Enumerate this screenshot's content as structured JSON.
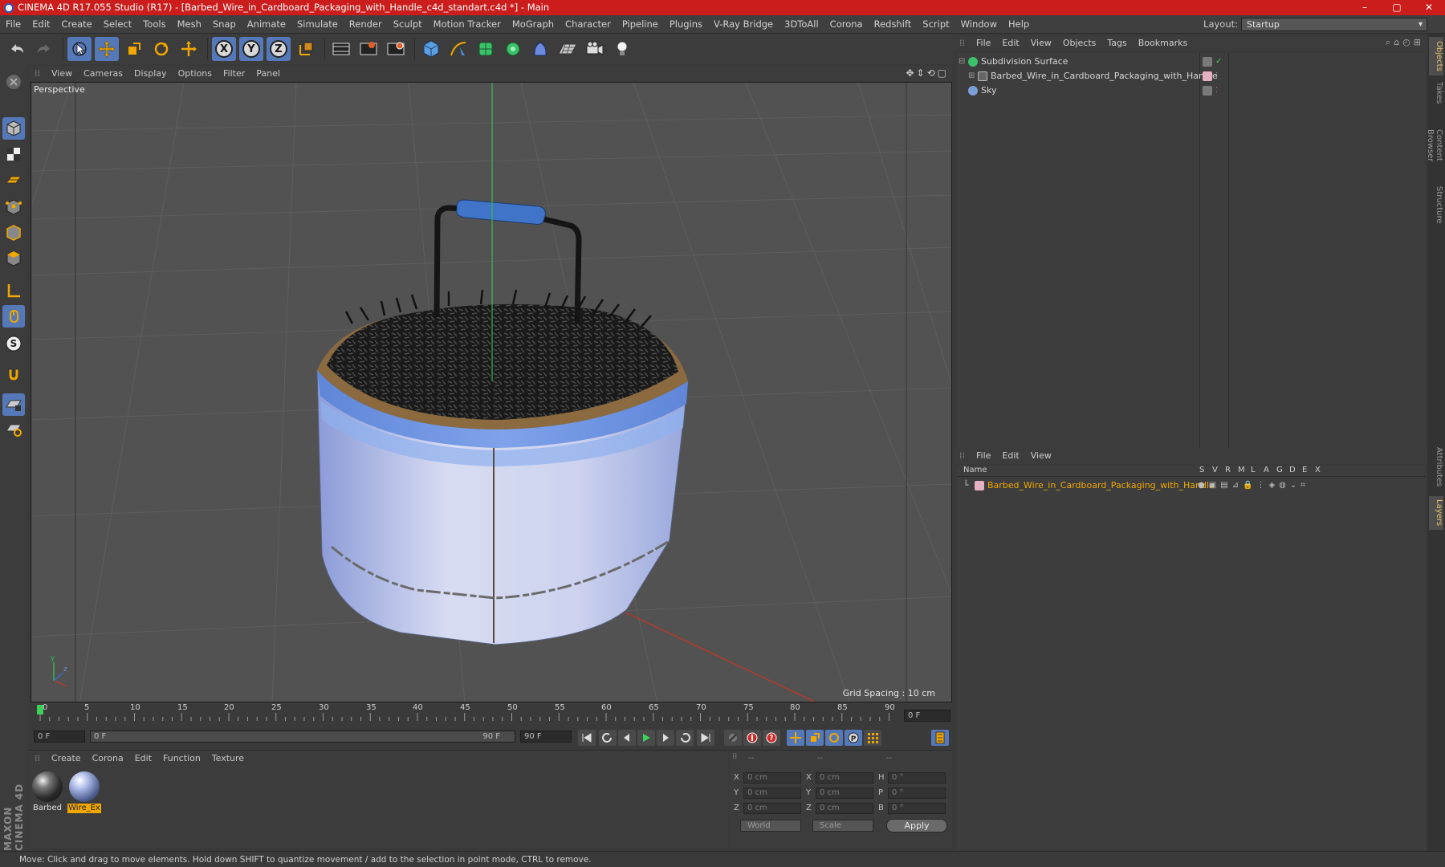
{
  "window": {
    "title": "CINEMA 4D R17.055 Studio (R17) - [Barbed_Wire_in_Cardboard_Packaging_with_Handle_c4d_standart.c4d *] - Main",
    "minimize": "–",
    "maximize": "▢",
    "close": "✕"
  },
  "menubar": {
    "items": [
      "File",
      "Edit",
      "Create",
      "Select",
      "Tools",
      "Mesh",
      "Snap",
      "Animate",
      "Simulate",
      "Render",
      "Sculpt",
      "Motion Tracker",
      "MoGraph",
      "Character",
      "Pipeline",
      "Plugins",
      "V-Ray Bridge",
      "3DToAll",
      "Corona",
      "Redshift",
      "Script",
      "Window",
      "Help"
    ],
    "layout_label": "Layout:",
    "layout_value": "Startup"
  },
  "toolbar": {
    "axis_x": "X",
    "axis_y": "Y",
    "axis_z": "Z"
  },
  "viewport": {
    "menu": [
      "View",
      "Cameras",
      "Display",
      "Options",
      "Filter",
      "Panel"
    ],
    "label": "Perspective",
    "grid_spacing": "Grid Spacing : 10 cm"
  },
  "timeline": {
    "ticks": [
      "0",
      "5",
      "10",
      "15",
      "20",
      "25",
      "30",
      "35",
      "40",
      "45",
      "50",
      "55",
      "60",
      "65",
      "70",
      "75",
      "80",
      "85",
      "90"
    ],
    "current_frame": "0 F",
    "start_field": "0 F",
    "range_start": "0 F",
    "range_end": "90 F",
    "end_field": "90 F"
  },
  "materials": {
    "menu": [
      "Create",
      "Corona",
      "Edit",
      "Function",
      "Texture"
    ],
    "items": [
      {
        "label": "Barbed",
        "selected": false
      },
      {
        "label": "Wire_Ex",
        "selected": true
      }
    ]
  },
  "coordinates": {
    "header": [
      "--",
      "--",
      "--"
    ],
    "rows": [
      {
        "a": "X",
        "av": "0 cm",
        "b": "X",
        "bv": "0 cm",
        "c": "H",
        "cv": "0 °"
      },
      {
        "a": "Y",
        "av": "0 cm",
        "b": "Y",
        "bv": "0 cm",
        "c": "P",
        "cv": "0 °"
      },
      {
        "a": "Z",
        "av": "0 cm",
        "b": "Z",
        "bv": "0 cm",
        "c": "B",
        "cv": "0 °"
      }
    ],
    "world": "World",
    "scale": "Scale",
    "apply": "Apply"
  },
  "status": "Move: Click and drag to move elements. Hold down SHIFT to quantize movement / add to the selection in point mode, CTRL to remove.",
  "objects_panel": {
    "menu": [
      "File",
      "Edit",
      "View",
      "Objects",
      "Tags",
      "Bookmarks"
    ],
    "items": [
      {
        "name": "Subdivision Surface",
        "level": 0
      },
      {
        "name": "Barbed_Wire_in_Cardboard_Packaging_with_Handle",
        "level": 1
      },
      {
        "name": "Sky",
        "level": 0
      }
    ]
  },
  "layers_panel": {
    "menu": [
      "File",
      "Edit",
      "View"
    ],
    "col_name": "Name",
    "cols": [
      "S",
      "V",
      "R",
      "M",
      "L",
      "A",
      "G",
      "D",
      "E",
      "X"
    ],
    "item": "Barbed_Wire_in_Cardboard_Packaging_with_Handle"
  },
  "side_tabs": [
    "Objects",
    "Takes",
    "Content Browser",
    "Structure",
    "Attributes",
    "Layers"
  ],
  "logo": "MAXON CINEMA 4D",
  "colors": {
    "title_bar": "#cc1d1d",
    "selection_blue": "#5579b8",
    "highlight_orange": "#f0a700"
  }
}
